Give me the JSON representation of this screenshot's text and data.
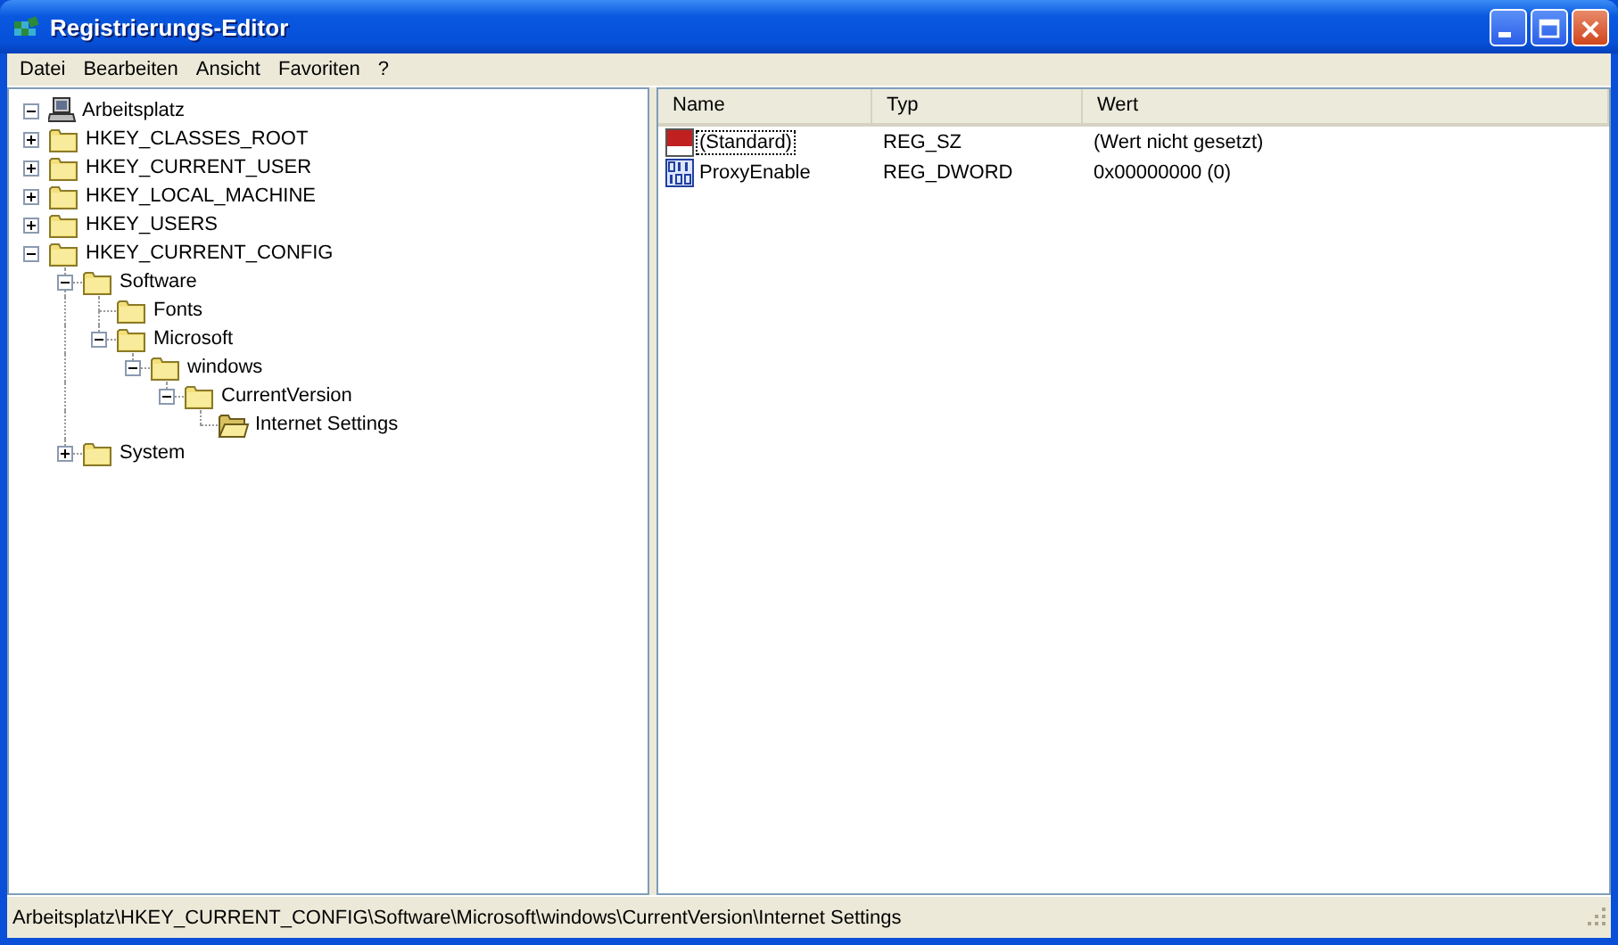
{
  "window": {
    "title": "Registrierungs-Editor"
  },
  "menu": [
    "Datei",
    "Bearbeiten",
    "Ansicht",
    "Favoriten",
    "?"
  ],
  "tree": {
    "label": "Arbeitsplatz",
    "kind": "computer",
    "expanded": true,
    "children": [
      {
        "label": "HKEY_CLASSES_ROOT",
        "kind": "folder",
        "expanded": false,
        "selected": false
      },
      {
        "label": "HKEY_CURRENT_USER",
        "kind": "folder",
        "expanded": false,
        "selected": false
      },
      {
        "label": "HKEY_LOCAL_MACHINE",
        "kind": "folder",
        "expanded": false,
        "selected": false
      },
      {
        "label": "HKEY_USERS",
        "kind": "folder",
        "expanded": false,
        "selected": false
      },
      {
        "label": "HKEY_CURRENT_CONFIG",
        "kind": "folder",
        "expanded": true,
        "selected": false,
        "children": [
          {
            "label": "Software",
            "kind": "folder",
            "expanded": true,
            "selected": false,
            "children": [
              {
                "label": "Fonts",
                "kind": "folder",
                "selected": false
              },
              {
                "label": "Microsoft",
                "kind": "folder",
                "expanded": true,
                "selected": false,
                "children": [
                  {
                    "label": "windows",
                    "kind": "folder",
                    "expanded": true,
                    "selected": false,
                    "children": [
                      {
                        "label": "CurrentVersion",
                        "kind": "folder",
                        "expanded": true,
                        "selected": false,
                        "children": [
                          {
                            "label": "Internet Settings",
                            "kind": "folder",
                            "selected": true
                          }
                        ]
                      }
                    ]
                  }
                ]
              }
            ]
          },
          {
            "label": "System",
            "kind": "folder",
            "expanded": false,
            "selected": false
          }
        ]
      }
    ]
  },
  "values": {
    "columns": [
      "Name",
      "Typ",
      "Wert"
    ],
    "rows": [
      {
        "kind": "string",
        "name": "(Standard)",
        "type": "REG_SZ",
        "data": "(Wert nicht gesetzt)",
        "focused": true
      },
      {
        "kind": "binary",
        "name": "ProxyEnable",
        "type": "REG_DWORD",
        "data": "0x00000000 (0)",
        "focused": false
      }
    ]
  },
  "status_bar": "Arbeitsplatz\\HKEY_CURRENT_CONFIG\\Software\\Microsoft\\windows\\CurrentVersion\\Internet Settings"
}
